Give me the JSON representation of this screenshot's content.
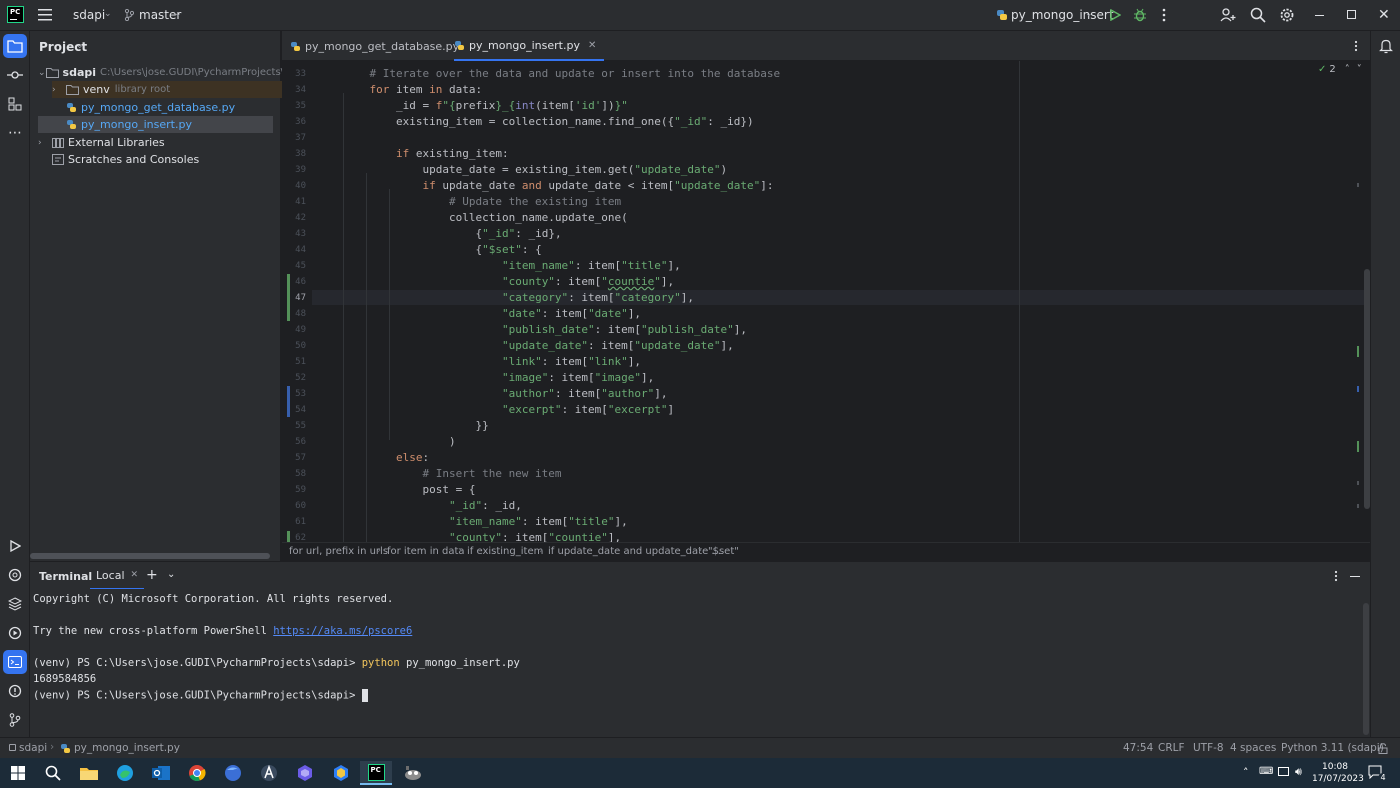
{
  "titlebar": {
    "project": "sdapi",
    "branch": "master",
    "run_config": "py_mongo_insert"
  },
  "project_panel": {
    "title": "Project",
    "root_name": "sdapi",
    "root_path": "C:\\Users\\jose.GUDI\\PycharmProjects\\sdapi",
    "venv": "venv",
    "venv_note": "library root",
    "file1": "py_mongo_get_database.py",
    "file2": "py_mongo_insert.py",
    "ext_libs": "External Libraries",
    "scratches": "Scratches and Consoles"
  },
  "tabs": [
    {
      "label": "py_mongo_get_database.py"
    },
    {
      "label": "py_mongo_insert.py"
    }
  ],
  "editor": {
    "problems_count": "2",
    "line_numbers": [
      "33",
      "34",
      "35",
      "36",
      "37",
      "38",
      "39",
      "40",
      "41",
      "42",
      "43",
      "44",
      "45",
      "46",
      "47",
      "48",
      "49",
      "50",
      "51",
      "52",
      "53",
      "54",
      "55",
      "56",
      "57",
      "58",
      "59",
      "60",
      "61",
      "62"
    ]
  },
  "breadcrumb": [
    "for url, prefix in urls",
    "for item in data",
    "if existing_item",
    "if update_date and update_date ...",
    "\"$set\""
  ],
  "terminal": {
    "title": "Terminal",
    "tab": "Local",
    "lines": [
      "Copyright (C) Microsoft Corporation. All rights reserved.",
      "",
      "Try the new cross-platform PowerShell ",
      "",
      "(venv) PS C:\\Users\\jose.GUDI\\PycharmProjects\\sdapi> ",
      "1689584856",
      "(venv) PS C:\\Users\\jose.GUDI\\PycharmProjects\\sdapi> "
    ],
    "link": "https://aka.ms/pscore6",
    "cmd": "python",
    "cmd_arg": " py_mongo_insert.py"
  },
  "status": {
    "project": "sdapi",
    "file": "py_mongo_insert.py",
    "position": "47:54",
    "line_ending": "CRLF",
    "encoding": "UTF-8",
    "indent": "4 spaces",
    "interpreter": "Python 3.11 (sdapi)"
  },
  "taskbar": {
    "time": "10:08",
    "date": "17/07/2023",
    "notifications": "4"
  },
  "colors": {
    "accent": "#3574f0",
    "keyword": "#cf8e6d",
    "string": "#6aab73",
    "comment": "#7a7e85"
  }
}
